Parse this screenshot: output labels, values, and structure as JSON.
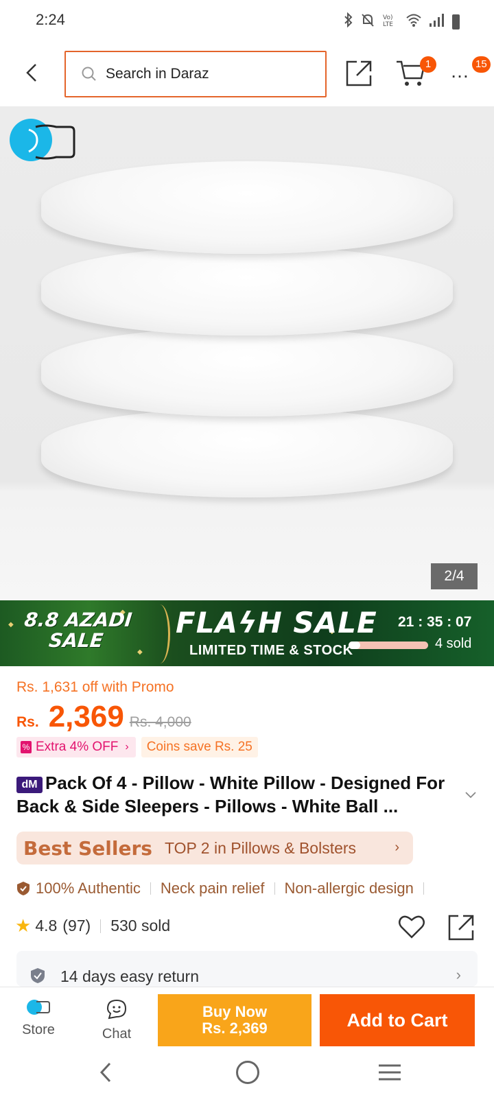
{
  "status_bar": {
    "time": "2:24",
    "icons": [
      "bluetooth-icon",
      "mute-icon",
      "volte-icon",
      "wifi-icon",
      "signal-icon",
      "battery-icon"
    ]
  },
  "header": {
    "search_placeholder": "Search in Daraz",
    "cart_count": "1",
    "more_count": "15"
  },
  "gallery": {
    "counter": "2/4"
  },
  "flash_sale": {
    "azadi_line1": "8.8 AZADI",
    "azadi_line2": "SALE",
    "title": "FLAϟH SALE",
    "subtitle": "LIMITED TIME & STOCK",
    "countdown": "21 : 35 : 07",
    "sold": "4 sold",
    "sold_fraction": 0.15
  },
  "price": {
    "promo": "Rs. 1,631 off with Promo",
    "currency": "Rs.",
    "current": "2,369",
    "original": "Rs. 4,000",
    "extra_off": "Extra 4% OFF",
    "coins": "Coins save Rs. 25"
  },
  "product": {
    "badge": "dM",
    "title": "Pack Of 4 - Pillow - White Pillow - Designed For Back & Side Sleepers - Pillows - White Ball ..."
  },
  "best_sellers": {
    "brand": "Best Sellers",
    "text": "TOP 2 in Pillows & Bolsters"
  },
  "features": [
    "100% Authentic",
    "Neck pain relief",
    "Non-allergic design"
  ],
  "rating": {
    "score": "4.8",
    "count": "(97)",
    "sold": "530 sold"
  },
  "return_policy": "14 days easy return",
  "actions": {
    "store": "Store",
    "chat": "Chat",
    "buy_now_line1": "Buy Now",
    "buy_now_line2": "Rs. 2,369",
    "add_to_cart": "Add to Cart"
  },
  "colors": {
    "accent": "#f85606",
    "buy_now": "#f9a51a",
    "search_border": "#e4642a"
  }
}
